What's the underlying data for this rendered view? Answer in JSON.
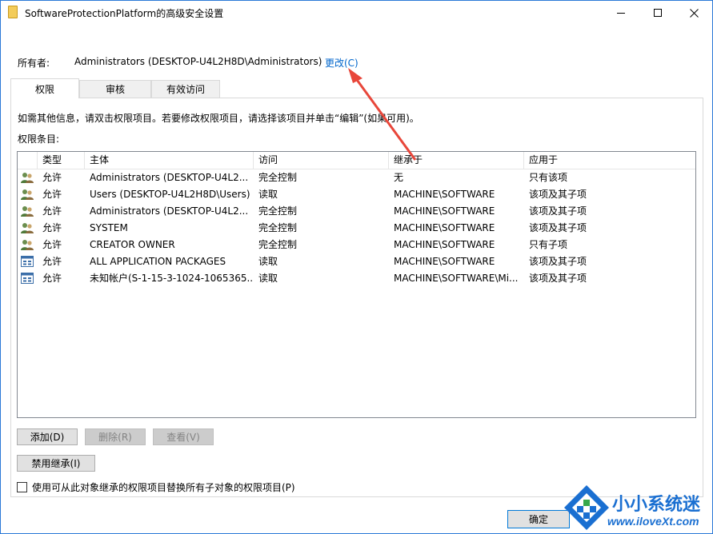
{
  "window": {
    "title": "SoftwareProtectionPlatform的高级安全设置",
    "controls": {
      "minimize": "minimize-icon",
      "maximize": "maximize-icon",
      "close": "close-icon"
    }
  },
  "owner": {
    "label": "所有者:",
    "value": "Administrators (DESKTOP-U4L2H8D\\Administrators)",
    "change_link": "更改(C)"
  },
  "tabs": [
    {
      "label": "权限",
      "active": true
    },
    {
      "label": "审核",
      "active": false
    },
    {
      "label": "有效访问",
      "active": false
    }
  ],
  "info_text": "如需其他信息，请双击权限项目。若要修改权限项目，请选择该项目并单击“编辑”(如果可用)。",
  "entries_label": "权限条目:",
  "columns": [
    "类型",
    "主体",
    "访问",
    "继承于",
    "应用于"
  ],
  "rows": [
    {
      "icon": "users-icon",
      "type": "允许",
      "principal": "Administrators (DESKTOP-U4L2...",
      "access": "完全控制",
      "inherited": "无",
      "applies": "只有该项"
    },
    {
      "icon": "users-icon",
      "type": "允许",
      "principal": "Users (DESKTOP-U4L2H8D\\Users)",
      "access": "读取",
      "inherited": "MACHINE\\SOFTWARE",
      "applies": "该项及其子项"
    },
    {
      "icon": "users-icon",
      "type": "允许",
      "principal": "Administrators (DESKTOP-U4L2...",
      "access": "完全控制",
      "inherited": "MACHINE\\SOFTWARE",
      "applies": "该项及其子项"
    },
    {
      "icon": "users-icon",
      "type": "允许",
      "principal": "SYSTEM",
      "access": "完全控制",
      "inherited": "MACHINE\\SOFTWARE",
      "applies": "该项及其子项"
    },
    {
      "icon": "users-icon",
      "type": "允许",
      "principal": "CREATOR OWNER",
      "access": "完全控制",
      "inherited": "MACHINE\\SOFTWARE",
      "applies": "只有子项"
    },
    {
      "icon": "app-package-icon",
      "type": "允许",
      "principal": "ALL APPLICATION PACKAGES",
      "access": "读取",
      "inherited": "MACHINE\\SOFTWARE",
      "applies": "该项及其子项"
    },
    {
      "icon": "app-package-icon",
      "type": "允许",
      "principal": "未知帐户(S-1-15-3-1024-1065365...",
      "access": "读取",
      "inherited": "MACHINE\\SOFTWARE\\Mi...",
      "applies": "该项及其子项"
    }
  ],
  "buttons": {
    "add": "添加(D)",
    "remove": "删除(R)",
    "view": "查看(V)",
    "disable_inheritance": "禁用继承(I)",
    "ok": "确定"
  },
  "replace_checkbox": {
    "label": "使用可从此对象继承的权限项目替换所有子对象的权限项目(P)",
    "checked": false
  },
  "watermark": {
    "title": "小小系统迷",
    "url": "www.iloveXt.com"
  },
  "colors": {
    "window_border": "#2b79d7",
    "link": "#0066cc",
    "annotation_arrow": "#e8473b",
    "watermark": "#1a6fd1"
  }
}
